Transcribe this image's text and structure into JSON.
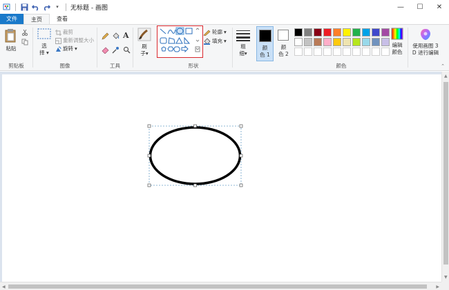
{
  "window": {
    "title": "无标题 - 画图",
    "controls": [
      "—",
      "☐",
      "✕"
    ]
  },
  "tabs": [
    {
      "label": "文件"
    },
    {
      "label": "主页"
    },
    {
      "label": "查看"
    }
  ],
  "clipboard": {
    "paste": "粘贴",
    "group": "剪贴板"
  },
  "image": {
    "select": "选",
    "select2": "择",
    "crop": "裁剪",
    "resize": "重新调整大小",
    "rotate": "旋转",
    "group": "图像"
  },
  "tools": {
    "group": "工具"
  },
  "brush": {
    "label": "刷",
    "label2": "子"
  },
  "shapes": {
    "outline": "轮廓",
    "fill": "填充",
    "group": "形状"
  },
  "size": {
    "label": "粗",
    "label2": "细"
  },
  "colors": {
    "color1": "颜",
    "color1b": "色 1",
    "color2": "颜",
    "color2b": "色 2",
    "edit": "编辑",
    "edit2": "颜色",
    "group": "颜色",
    "current1": "#000000",
    "current2": "#ffffff",
    "palette_row1": [
      "#000000",
      "#7f7f7f",
      "#880015",
      "#ed1c24",
      "#ff7f27",
      "#fff200",
      "#22b14c",
      "#00a2e8",
      "#3f48cc",
      "#a349a4"
    ],
    "palette_row2": [
      "#ffffff",
      "#c3c3c3",
      "#b97a57",
      "#ffaec9",
      "#ffc90e",
      "#efe4b0",
      "#b5e61d",
      "#99d9ea",
      "#7092be",
      "#c8bfe7"
    ]
  },
  "paint3d": {
    "label": "使用画图 3",
    "label2": "D 进行编辑"
  }
}
